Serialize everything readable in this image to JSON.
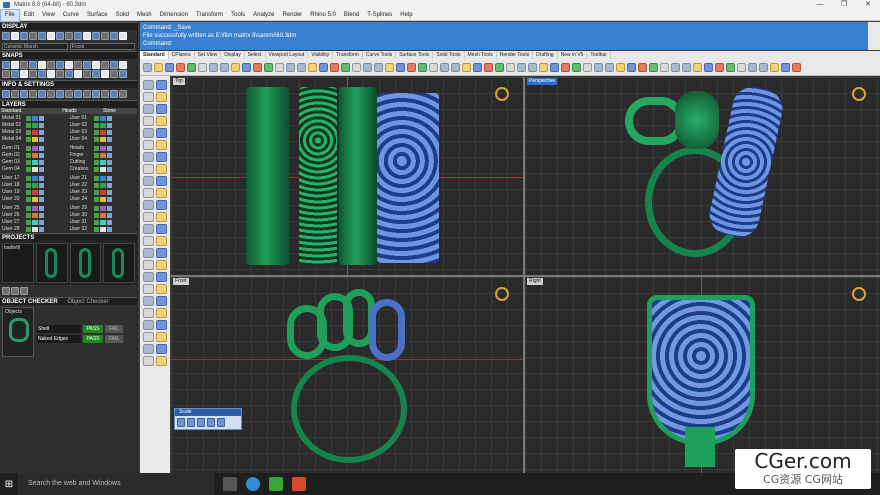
{
  "window": {
    "title": "Matrix 8.0 (64-bit) - 60.3dm",
    "controls": [
      "—",
      "❐",
      "✕"
    ]
  },
  "menu": [
    "File",
    "Edit",
    "View",
    "Curve",
    "Surface",
    "Solid",
    "Mesh",
    "Dimension",
    "Transform",
    "Tools",
    "Analyze",
    "Render",
    "Rhino 5.0",
    "Blend",
    "T-Splines",
    "Help"
  ],
  "left_panel": {
    "display_label": "DISPLAY",
    "display_inputs": [
      "Ceramic Marsh",
      "Frustr"
    ],
    "snaps_label": "SNAPS",
    "info_label": "INFO & SETTINGS",
    "layers_label": "LAYERS",
    "layer_headers": [
      "Standard",
      "Heads",
      "Stone"
    ],
    "layers_left": [
      "Metal 01",
      "Metal 02",
      "Metal 03",
      "Metal 04",
      "Gem 01",
      "Gem 02",
      "Gem 03",
      "Gem 04",
      "User 17",
      "User 18",
      "User 19",
      "User 20",
      "User 25",
      "User 26",
      "User 27",
      "User 28"
    ],
    "layers_right": [
      "User 01",
      "User 02",
      "User 03",
      "User 04",
      "Heads",
      "Finger",
      "Cutting",
      "Creation",
      "User 21",
      "User 22",
      "User 23",
      "User 24",
      "User 29",
      "User 30",
      "User 31",
      "User 32"
    ],
    "projects_label": "PROJECTS",
    "projects_tab": "battlefil",
    "object_checker_label": "OBJECT CHECKER",
    "object_checker_tab": "Object Checker",
    "objects_label": "Objects",
    "checks": [
      {
        "label": "Shell",
        "pass": "PASS",
        "fail": "FAIL"
      },
      {
        "label": "Naked Edges",
        "pass": "PASS",
        "fail": "FAIL"
      }
    ]
  },
  "command": {
    "line1": "Command: _Save",
    "line2": "File successfully written as E:\\film matrix 8\\sammi\\60.3dm",
    "line3": "Command:"
  },
  "tabs": [
    "Standard",
    "CPlanes",
    "Set View",
    "Display",
    "Select",
    "Viewport Layout",
    "Visibility",
    "Transform",
    "Curve Tools",
    "Surface Tools",
    "Solid Tools",
    "Mesh Tools",
    "Render Tools",
    "Drafting",
    "New in V5",
    "Toolbar"
  ],
  "viewports": {
    "top": "Top",
    "perspective": "Perspective",
    "front": "Front",
    "right": "Right"
  },
  "scale_panel": {
    "title": "Scale"
  },
  "taskbar": {
    "start_icon": "⊞",
    "search_placeholder": "Search the web and Windows"
  },
  "watermark": {
    "line1": "CGer.com",
    "line2": "CG资源 CG网站"
  }
}
